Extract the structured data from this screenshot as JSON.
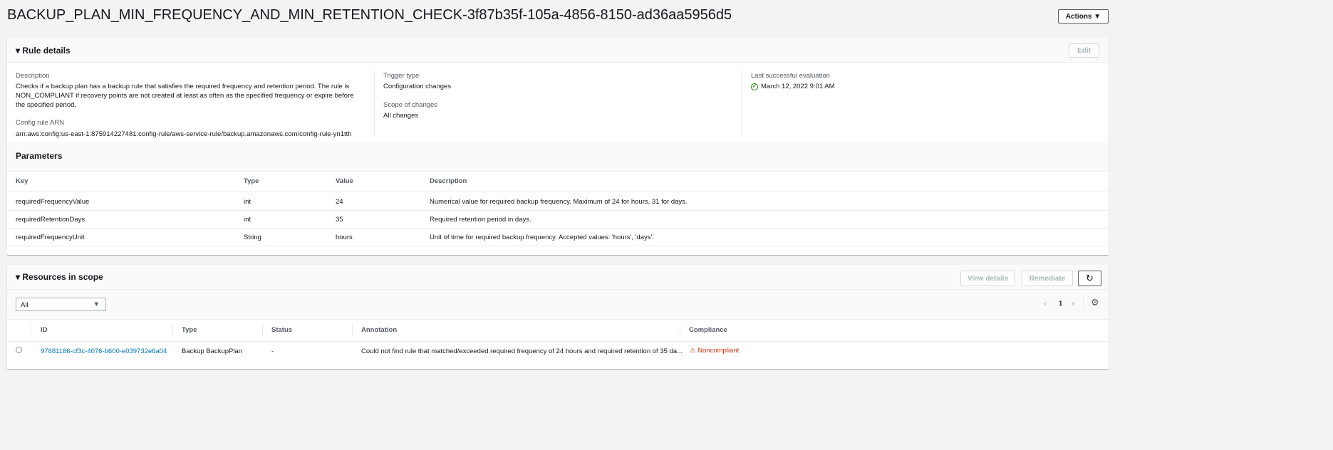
{
  "title": "BACKUP_PLAN_MIN_FREQUENCY_AND_MIN_RETENTION_CHECK-3f87b35f-105a-4856-8150-ad36aa5956d5",
  "actions_label": "Actions ▼",
  "rule_details": {
    "header": "Rule details",
    "edit_label": "Edit",
    "description_label": "Description",
    "description": "Checks if a backup plan has a backup rule that satisfies the required frequency and retention period. The rule is NON_COMPLIANT if recovery points are not created at least as often as the specified frequency or expire before the specified period.",
    "arn_label": "Config rule ARN",
    "arn": "arn:aws:config:us-east-1:875914227481:config-rule/aws-service-rule/backup.amazonaws.com/config-rule-yn1tth",
    "trigger_label": "Trigger type",
    "trigger": "Configuration changes",
    "scope_label": "Scope of changes",
    "scope": "All changes",
    "last_eval_label": "Last successful evaluation",
    "last_eval": "March 12, 2022 9:01 AM"
  },
  "parameters": {
    "header": "Parameters",
    "columns": [
      "Key",
      "Type",
      "Value",
      "Description"
    ],
    "rows": [
      [
        "requiredFrequencyValue",
        "int",
        "24",
        "Numerical value for required backup frequency. Maximum of 24 for hours, 31 for days."
      ],
      [
        "requiredRetentionDays",
        "int",
        "35",
        "Required retention period in days."
      ],
      [
        "requiredFrequencyUnit",
        "String",
        "hours",
        "Unit of time for required backup frequency. Accepted values: 'hours', 'days'."
      ]
    ]
  },
  "resources": {
    "header": "Resources in scope",
    "view_details": "View details",
    "remediate": "Remediate",
    "filter": "All",
    "page": "1",
    "columns": [
      "ID",
      "Type",
      "Status",
      "Annotation",
      "Compliance"
    ],
    "rows": [
      [
        "97681186-cf3c-4076-b600-e039732e6a04",
        "Backup BackupPlan",
        "-",
        "Could not find rule that matched/exceeded required frequency of 24 hours and required retention of 35 da...",
        "Noncompliant"
      ]
    ]
  }
}
